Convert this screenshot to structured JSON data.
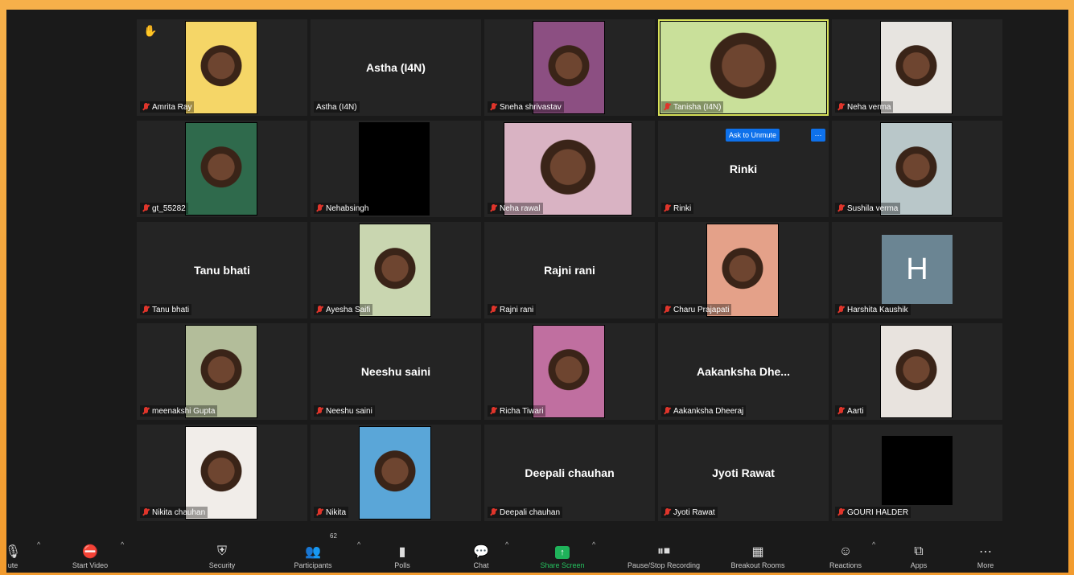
{
  "participants": [
    {
      "name": "Amrita Ray",
      "display": "",
      "video": true,
      "bg": "#f5d667"
    },
    {
      "name": "Astha (I4N)",
      "display": "Astha (I4N)",
      "video": false
    },
    {
      "name": "Sneha shrivastav",
      "display": "",
      "video": true,
      "bg": "#8c4f82"
    },
    {
      "name": "Tanisha (I4N)",
      "display": "",
      "video": true,
      "bg": "#c9e09a"
    },
    {
      "name": "Neha verma",
      "display": "",
      "video": true,
      "bg": "#e7e4e0"
    },
    {
      "name": "gt_55282",
      "display": "",
      "video": true,
      "bg": "#2f6a4c"
    },
    {
      "name": "Nehabsingh",
      "display": "",
      "video": false,
      "black": true
    },
    {
      "name": "Neha rawal",
      "display": "",
      "video": true,
      "bg": "#d9b3c3"
    },
    {
      "name": "Rinki",
      "display": "Rinki",
      "video": false
    },
    {
      "name": "Sushila verma",
      "display": "",
      "video": true,
      "bg": "#b9c7c9"
    },
    {
      "name": "Tanu bhati",
      "display": "Tanu bhati",
      "video": false
    },
    {
      "name": "Ayesha Saifi",
      "display": "",
      "video": true,
      "bg": "#c9d6b0"
    },
    {
      "name": "Rajni rani",
      "display": "Rajni rani",
      "video": false
    },
    {
      "name": "Charu Prajapati",
      "display": "",
      "video": true,
      "bg": "#e4a189"
    },
    {
      "name": "Harshita Kaushik",
      "display": "",
      "video": false,
      "letter": "H"
    },
    {
      "name": "meenakshi Gupta",
      "display": "",
      "video": true,
      "bg": "#b3bd9a"
    },
    {
      "name": "Neeshu saini",
      "display": "Neeshu saini",
      "video": false
    },
    {
      "name": "Richa Tiwari",
      "display": "",
      "video": true,
      "bg": "#c06fa0"
    },
    {
      "name": "Aakanksha  Dheeraj",
      "display": "Aakanksha  Dhe...",
      "video": false
    },
    {
      "name": "Aarti",
      "display": "",
      "video": true,
      "bg": "#e8e3de"
    },
    {
      "name": "Nikita chauhan",
      "display": "",
      "video": true,
      "bg": "#f1ede9"
    },
    {
      "name": "Nikita",
      "display": "",
      "video": true,
      "bg": "#5aa6d8"
    },
    {
      "name": "Deepali chauhan",
      "display": "Deepali chauhan",
      "video": false
    },
    {
      "name": "Jyoti Rawat",
      "display": "Jyoti Rawat",
      "video": false
    },
    {
      "name": "GOURI HALDER",
      "display": "",
      "video": false,
      "black": true
    }
  ],
  "raised_hand_icon": "hand-icon",
  "ask_to_unmute": "Ask to Unmute",
  "more_dots": "···",
  "letter_avatar": "H",
  "toolbar": {
    "unmute": "ute",
    "start_video": "Start Video",
    "security": "Security",
    "participants": "Participants",
    "participants_count": "62",
    "polls": "Polls",
    "chat": "Chat",
    "share_screen": "Share Screen",
    "recording": "Pause/Stop Recording",
    "breakout": "Breakout Rooms",
    "reactions": "Reactions",
    "apps": "Apps",
    "more": "More"
  },
  "colors": {
    "speaking_border": "#d8e25a",
    "unmute_blue": "#0e71eb",
    "share_green": "#1fb35a",
    "mic_muted": "#e0352b"
  }
}
